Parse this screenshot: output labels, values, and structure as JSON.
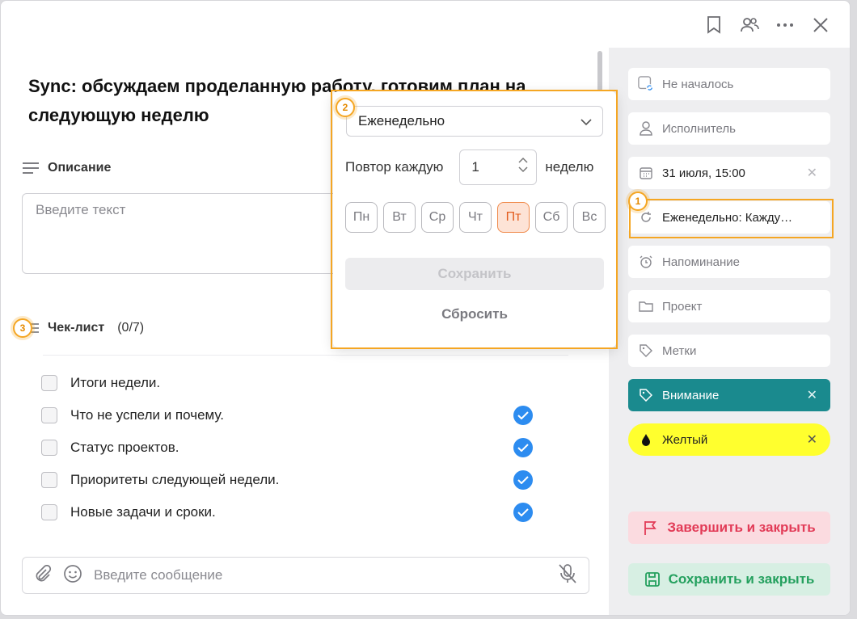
{
  "header": {
    "icons": [
      "bookmark-icon",
      "users-icon",
      "more-icon",
      "close-icon"
    ]
  },
  "task": {
    "title": "Sync: обсуждаем проделанную работу, готовим план на следующую неделю"
  },
  "description": {
    "label": "Описание",
    "placeholder": "Введите текст"
  },
  "checklist": {
    "label": "Чек-лист",
    "count": "(0/7)",
    "items": [
      {
        "text": "Итоги недели.",
        "done_mark": false
      },
      {
        "text": "Что не успели и почему.",
        "done_mark": true
      },
      {
        "text": "Статус проектов.",
        "done_mark": true
      },
      {
        "text": "Приоритеты следующей недели.",
        "done_mark": true
      },
      {
        "text": "Новые задачи и сроки.",
        "done_mark": true
      }
    ]
  },
  "message": {
    "placeholder": "Введите сообщение"
  },
  "sidebar": {
    "status": "Не началось",
    "assignee": "Исполнитель",
    "date": "31 июля, 15:00",
    "repeat": "Еженедельно: Кажду…",
    "reminder": "Напоминание",
    "project": "Проект",
    "tags": "Метки",
    "tag_attention": "Внимание",
    "tag_color": "Желтый",
    "finish_button": "Завершить и закрыть",
    "save_button": "Сохранить и закрыть"
  },
  "colors": {
    "teal_tag": "#1a8a8e",
    "yellow_tag": "#ffff2e",
    "annotation": "#f5a623",
    "active_day": "#fde3d6"
  },
  "repeat_popup": {
    "frequency": "Еженедельно",
    "repeat_label": "Повтор каждую",
    "interval": "1",
    "unit": "неделю",
    "days": [
      "Пн",
      "Вт",
      "Ср",
      "Чт",
      "Пт",
      "Сб",
      "Вс"
    ],
    "active_day": "Пт",
    "save": "Сохранить",
    "reset": "Сбросить"
  },
  "annotations": {
    "badge1": "1",
    "badge2": "2",
    "badge3": "3"
  }
}
